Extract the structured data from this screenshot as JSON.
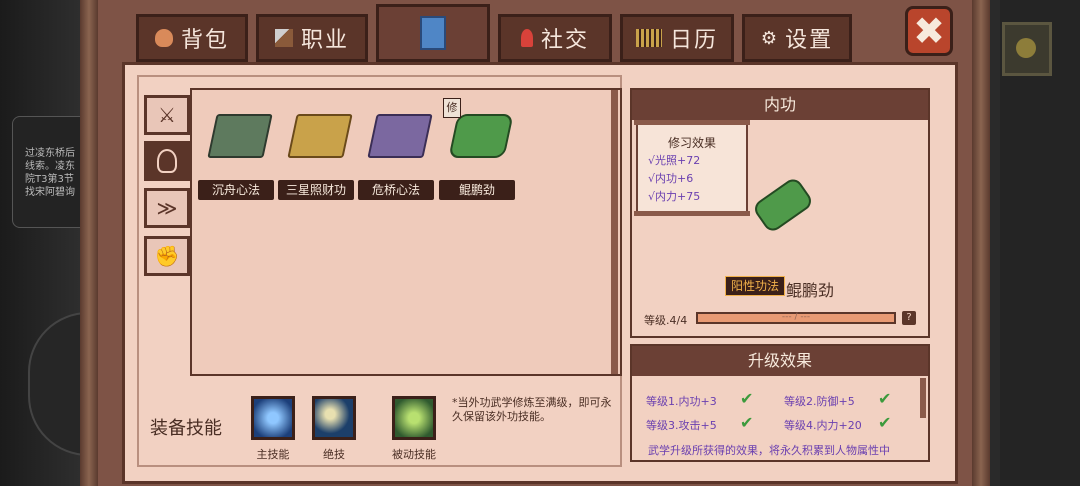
{
  "tabs": [
    {
      "label": "背包",
      "icon": "bag-icon"
    },
    {
      "label": "职业",
      "icon": "hammer-icon"
    },
    {
      "label": "",
      "icon": "book-icon"
    },
    {
      "label": "社交",
      "icon": "person-icon"
    },
    {
      "label": "日历",
      "icon": "calendar-icon"
    },
    {
      "label": "设置",
      "icon": "gear-icon"
    }
  ],
  "close_icon": "✖",
  "bg_hint": {
    "l1": "过凌东桥后",
    "l2": "线索。凌东",
    "l3": "院T3第3节",
    "l4": "找宋阿碧询"
  },
  "sidebar": [
    "sword-icon",
    "meditation-icon",
    "dash-icon",
    "fist-icon"
  ],
  "items": [
    {
      "name": "沉舟心法",
      "color": "#5e7a5e"
    },
    {
      "name": "三星照财功",
      "color": "#c9a24a"
    },
    {
      "name": "危桥心法",
      "color": "#7b68a0"
    },
    {
      "name": "鲲鹏劲",
      "color": "#4f9a4a"
    }
  ],
  "item_badge": "修",
  "equip": {
    "title": "装备技能",
    "slots": [
      {
        "label": "主技能",
        "color": "#2a63b8"
      },
      {
        "label": "绝技",
        "color": "#2a5f9a"
      },
      {
        "label": "被动技能",
        "color": "#3d7a3d"
      }
    ],
    "note": "*当外功武学修炼至满级，即可永久保留该外功技能。"
  },
  "detail": {
    "header": "内功",
    "scroll_title": "修习效果",
    "effects": [
      "√光照+72",
      "√内功+6",
      "√内力+75"
    ],
    "tag": "阳性功法",
    "skill_name": "鲲鹏劲",
    "level_label": "等级.4/4",
    "level_progress": 1.0,
    "bar_text": "--- / ---",
    "help": "?"
  },
  "upgrade": {
    "header": "升级效果",
    "rows": [
      {
        "text": "等级1.内功+3",
        "check": "✔"
      },
      {
        "text": "等级2.防御+5",
        "check": "✔"
      },
      {
        "text": "等级3.攻击+5",
        "check": "✔"
      },
      {
        "text": "等级4.内力+20",
        "check": "✔"
      }
    ],
    "desc": "武学升级所获得的效果，将永久积累到人物属性中"
  }
}
